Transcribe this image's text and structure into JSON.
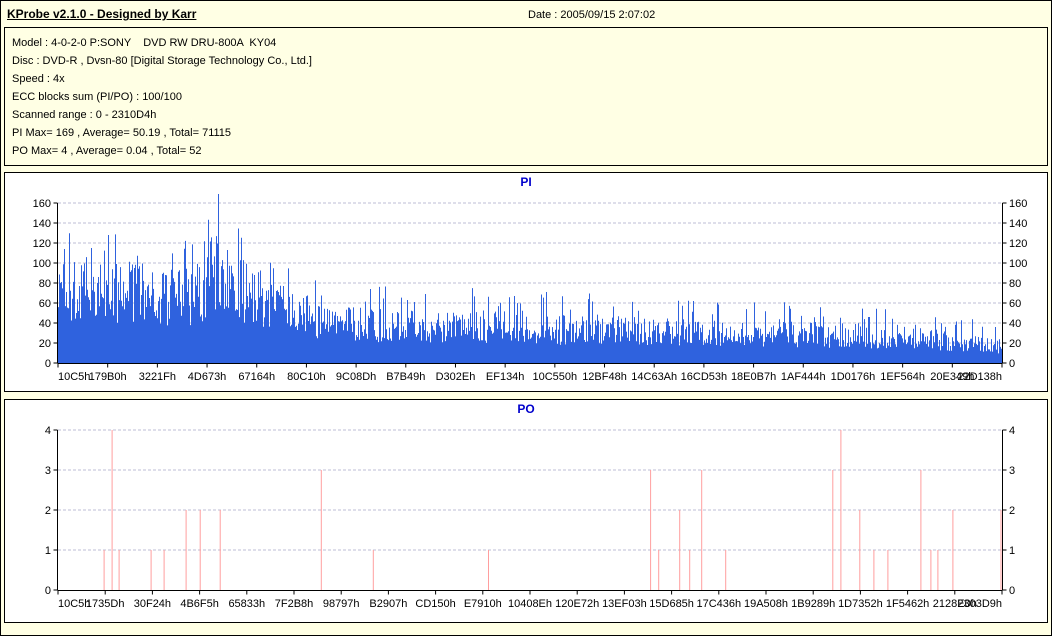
{
  "header": {
    "app_title": "KProbe v2.1.0 - Designed by Karr",
    "date_label": "Date : 2005/09/15 2:07:02",
    "info_lines": [
      "Model : 4-0-2-0 P:SONY    DVD RW DRU-800A  KY04",
      "Disc : DVD-R , Dvsn-80 [Digital Storage Technology Co., Ltd.]",
      "Speed : 4x",
      "ECC blocks sum (PI/PO) : 100/100",
      "Scanned range : 0 - 2310D4h",
      "PI Max= 169 , Average= 50.19 , Total= 71115",
      "PO Max= 4 , Average= 0.04 , Total= 52"
    ]
  },
  "colors": {
    "background": "#ffffe4",
    "panel_bg": "#ffffff",
    "chart_title": "#0000cc",
    "pi_bar": "#2f62de",
    "po_spike": "#ff9e9e",
    "gridline": "#bcbcd4",
    "axis": "#000000"
  },
  "chart_data": [
    {
      "type": "bar",
      "title": "PI",
      "xlabel": "",
      "ylabel": "",
      "ylim": [
        0,
        160
      ],
      "yticks": [
        0,
        20,
        40,
        60,
        80,
        100,
        120,
        140,
        160
      ],
      "x_tick_labels": [
        "10C5h",
        "179B0h",
        "3221Fh",
        "4D673h",
        "67164h",
        "80C10h",
        "9C08Dh",
        "B7B49h",
        "D302Eh",
        "EF134h",
        "10C550h",
        "12BF48h",
        "14C63Ah",
        "16CD53h",
        "18E0B7h",
        "1AF444h",
        "1D0176h",
        "1EF564h",
        "20E349h",
        "22D138h"
      ],
      "grid": true,
      "legend": "none",
      "stats": {
        "max": 169,
        "average": 50.19,
        "total": 71115
      },
      "max_value": 169,
      "max_at_fraction": 0.17,
      "seed": 1337,
      "envelope_points": [
        [
          0.0,
          95,
          145
        ],
        [
          0.03,
          90,
          138
        ],
        [
          0.06,
          87,
          133
        ],
        [
          0.1,
          83,
          128
        ],
        [
          0.13,
          80,
          124
        ],
        [
          0.15,
          84,
          128
        ],
        [
          0.162,
          108,
          160
        ],
        [
          0.17,
          112,
          169
        ],
        [
          0.18,
          98,
          148
        ],
        [
          0.195,
          88,
          132
        ],
        [
          0.215,
          78,
          118
        ],
        [
          0.235,
          68,
          108
        ],
        [
          0.255,
          60,
          98
        ],
        [
          0.27,
          54,
          88
        ],
        [
          0.285,
          46,
          78
        ],
        [
          0.3,
          48,
          80
        ],
        [
          0.33,
          46,
          78
        ],
        [
          0.36,
          44,
          76
        ],
        [
          0.4,
          43,
          74
        ],
        [
          0.44,
          45,
          78
        ],
        [
          0.48,
          43,
          76
        ],
        [
          0.52,
          41,
          73
        ],
        [
          0.56,
          40,
          72
        ],
        [
          0.6,
          39,
          70
        ],
        [
          0.64,
          40,
          71
        ],
        [
          0.68,
          38,
          69
        ],
        [
          0.72,
          37,
          67
        ],
        [
          0.76,
          35,
          64
        ],
        [
          0.8,
          34,
          62
        ],
        [
          0.84,
          33,
          60
        ],
        [
          0.88,
          31,
          57
        ],
        [
          0.92,
          29,
          54
        ],
        [
          0.95,
          26,
          50
        ],
        [
          0.975,
          23,
          46
        ],
        [
          1.0,
          21,
          42
        ]
      ]
    },
    {
      "type": "bar",
      "title": "PO",
      "xlabel": "",
      "ylabel": "",
      "ylim": [
        0,
        4
      ],
      "yticks": [
        0,
        1,
        2,
        3,
        4
      ],
      "x_tick_labels": [
        "10C5h",
        "1735Dh",
        "30F24h",
        "4B6F5h",
        "65833h",
        "7F2B8h",
        "98797h",
        "B2907h",
        "CD150h",
        "E7910h",
        "10408Eh",
        "120E72h",
        "13EF03h",
        "15D685h",
        "17C436h",
        "19A508h",
        "1B9289h",
        "1D7352h",
        "1F5462h",
        "2128E0h",
        "2303D9h"
      ],
      "grid": true,
      "legend": "none",
      "stats": {
        "max": 4,
        "average": 0.04,
        "total": 52
      },
      "spikes": [
        [
          0.0488,
          1
        ],
        [
          0.0573,
          4
        ],
        [
          0.0647,
          1
        ],
        [
          0.0986,
          1
        ],
        [
          0.1124,
          1
        ],
        [
          0.1357,
          2
        ],
        [
          0.1506,
          2
        ],
        [
          0.1718,
          2
        ],
        [
          0.2789,
          3
        ],
        [
          0.334,
          1
        ],
        [
          0.456,
          1
        ],
        [
          0.6278,
          3
        ],
        [
          0.6363,
          1
        ],
        [
          0.6586,
          2
        ],
        [
          0.6692,
          1
        ],
        [
          0.6819,
          3
        ],
        [
          0.7073,
          1
        ],
        [
          0.8208,
          3
        ],
        [
          0.8293,
          4
        ],
        [
          0.8494,
          2
        ],
        [
          0.8643,
          1
        ],
        [
          0.8791,
          1
        ],
        [
          0.9141,
          3
        ],
        [
          0.9247,
          1
        ],
        [
          0.9321,
          1
        ],
        [
          0.948,
          2
        ],
        [
          0.9989,
          2
        ]
      ]
    }
  ]
}
